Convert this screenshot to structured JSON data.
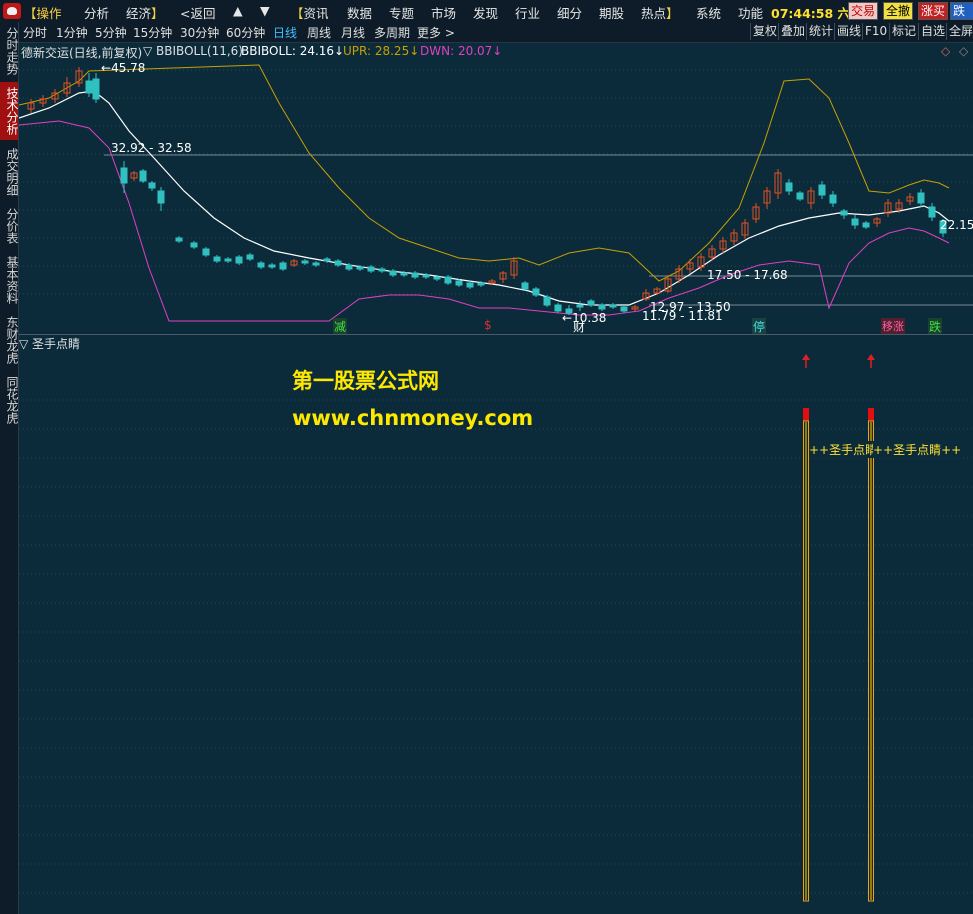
{
  "menu": {
    "items": [
      "操作",
      "分析",
      "经济",
      "<返回",
      "▲",
      "▼",
      "资讯",
      "数据",
      "专题",
      "市场",
      "发现",
      "行业",
      "细分",
      "期股",
      "热点",
      "系统",
      "功能"
    ],
    "clock": "07:44:58",
    "clock_suffix": "六",
    "buttons": [
      {
        "label": "交易",
        "bg": "#f0c8c8",
        "fg": "#c00000"
      },
      {
        "label": "全撤",
        "bg": "#f0e040",
        "fg": "#000000"
      },
      {
        "label": "涨买",
        "bg": "#c02020",
        "fg": "#ffffff"
      },
      {
        "label": "跌卖",
        "bg": "#2060c0",
        "fg": "#ffffff"
      }
    ]
  },
  "sidebar": {
    "tabs": [
      "分时走势",
      "技术分析",
      "成交明细",
      "分价表",
      "基本资料",
      "东财龙虎",
      "同花龙虎"
    ],
    "active_index": 1
  },
  "periods": {
    "items": [
      "分时",
      "1分钟",
      "5分钟",
      "15分钟",
      "30分钟",
      "60分钟",
      "日线",
      "周线",
      "月线",
      "多周期",
      "更多 >"
    ],
    "active": "日线"
  },
  "tools": [
    "复权",
    "叠加",
    "统计",
    "画线",
    "F10",
    "标记",
    "自选",
    "全屏"
  ],
  "chart": {
    "title": "德新交运(日线,前复权)",
    "indicator_name": "▽ BBIBOLL(11,6)",
    "bbiboll": "BBIBOLL: 24.16↓",
    "upr": "UPR: 28.25↓",
    "dwn": "DWN: 20.07↓",
    "colors": {
      "bbiboll": "#ffffff",
      "upr": "#c8a000",
      "dwn": "#e040c0",
      "up": "#e05020",
      "down": "#30c0c0",
      "bg": "#0b2b3b"
    },
    "annotations": {
      "high": "45.78",
      "low": "10.38",
      "last": "22.15",
      "range1": "32.92 - 32.58",
      "range2": "17.50 - 17.68",
      "range3": "12.97 - 13.50",
      "range4": "11.79 - 11.81"
    },
    "markers": [
      {
        "label": "减",
        "color": "#40e040"
      },
      {
        "label": "$",
        "color": "#e03030"
      },
      {
        "label": "财",
        "color": "#ffffff"
      },
      {
        "label": "停",
        "color": "#40e0e0"
      },
      {
        "label": "移涨",
        "color": "#ff60a0"
      },
      {
        "label": "跌",
        "color": "#40e040"
      }
    ]
  },
  "indicator": {
    "name": "▽ 圣手点睛",
    "signal_label": "++圣手点睛++",
    "watermark_title": "第一股票公式网",
    "watermark_url": "www.chnmoney.com"
  }
}
